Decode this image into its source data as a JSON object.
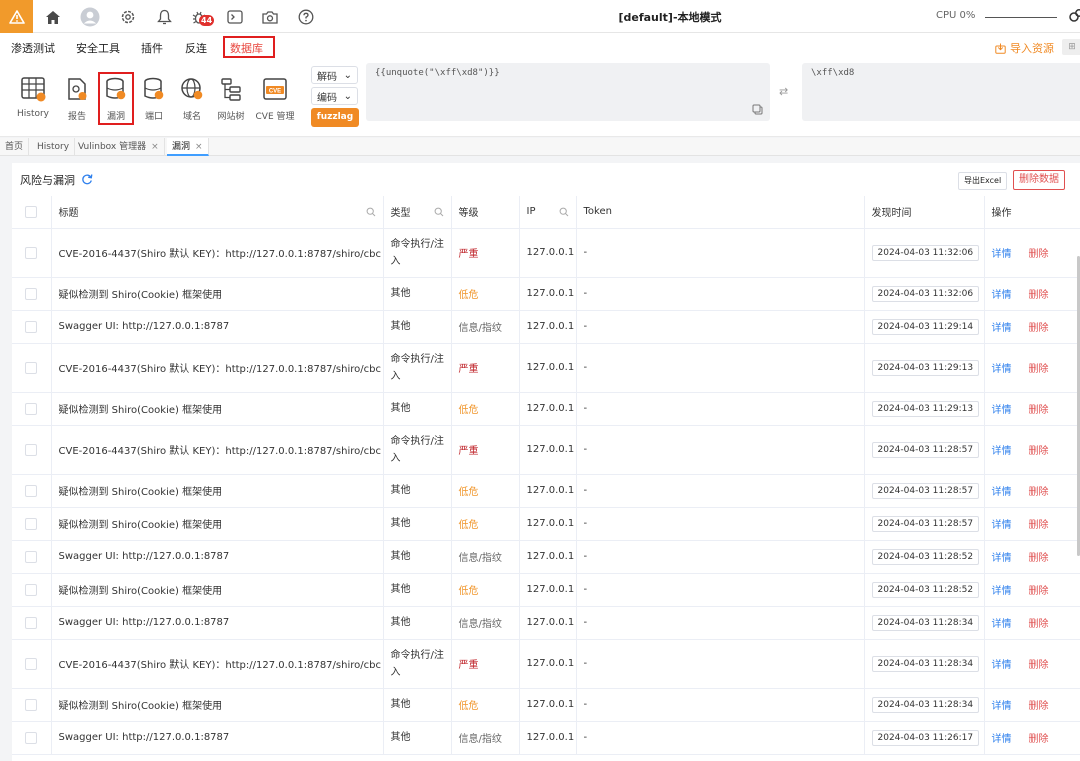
{
  "topbar": {
    "title": "[default]-本地模式",
    "cpu": "CPU 0%",
    "bug_count": "44",
    "icons": [
      "warning-icon",
      "home-icon",
      "user-icon",
      "settings-icon",
      "bell-icon",
      "bug-icon",
      "terminal-icon",
      "camera-icon",
      "help-icon"
    ]
  },
  "menu": {
    "items": [
      "渗透测试",
      "安全工具",
      "插件",
      "反连",
      "数据库"
    ],
    "active_index": 4,
    "import_label": "导入资源"
  },
  "toolbar": {
    "tools": [
      {
        "label": "History",
        "icon": "table-icon"
      },
      {
        "label": "报告",
        "icon": "report-icon"
      },
      {
        "label": "漏洞",
        "icon": "vuln-db-icon"
      },
      {
        "label": "端口",
        "icon": "port-db-icon"
      },
      {
        "label": "域名",
        "icon": "globe-icon"
      },
      {
        "label": "网站树",
        "icon": "tree-icon"
      },
      {
        "label": "CVE 管理",
        "icon": "cve-icon"
      }
    ],
    "decode_label": "解码",
    "encode_label": "编码",
    "fuzz_label": "fuzzlag",
    "input_text": "{{unquote(\"\\xff\\xd8\")}}",
    "output_text": "\\xff\\xd8"
  },
  "tabs": [
    {
      "label": "首页",
      "closable": false
    },
    {
      "label": "History",
      "closable": false
    },
    {
      "label": "Vulinbox 管理器",
      "closable": true
    },
    {
      "label": "漏洞",
      "closable": true,
      "active": true
    }
  ],
  "panel": {
    "title": "风险与漏洞",
    "export_label": "导出Excel",
    "delete_all_label": "删除数据"
  },
  "columns": [
    "标题",
    "类型",
    "等级",
    "IP",
    "Token",
    "发现时间",
    "操作"
  ],
  "actions": {
    "detail": "详情",
    "delete": "删除"
  },
  "rows": [
    {
      "title": "CVE-2016-4437(Shiro 默认 KEY)：http://127.0.0.1:8787/shiro/cbc",
      "type": "命令执行/注入",
      "level": "严重",
      "lv": "crit",
      "ip": "127.0.0.1",
      "token": "-",
      "time": "2024-04-03 11:32:06",
      "tall": true
    },
    {
      "title": "疑似检测到 Shiro(Cookie) 框架使用",
      "type": "其他",
      "level": "低危",
      "lv": "low",
      "ip": "127.0.0.1",
      "token": "-",
      "time": "2024-04-03 11:32:06",
      "tall": false
    },
    {
      "title": "Swagger UI: http://127.0.0.1:8787",
      "type": "其他",
      "level": "信息/指纹",
      "lv": "info",
      "ip": "127.0.0.1",
      "token": "-",
      "time": "2024-04-03 11:29:14",
      "tall": false
    },
    {
      "title": "CVE-2016-4437(Shiro 默认 KEY)：http://127.0.0.1:8787/shiro/cbc",
      "type": "命令执行/注入",
      "level": "严重",
      "lv": "crit",
      "ip": "127.0.0.1",
      "token": "-",
      "time": "2024-04-03 11:29:13",
      "tall": true
    },
    {
      "title": "疑似检测到 Shiro(Cookie) 框架使用",
      "type": "其他",
      "level": "低危",
      "lv": "low",
      "ip": "127.0.0.1",
      "token": "-",
      "time": "2024-04-03 11:29:13",
      "tall": false
    },
    {
      "title": "CVE-2016-4437(Shiro 默认 KEY)：http://127.0.0.1:8787/shiro/cbc",
      "type": "命令执行/注入",
      "level": "严重",
      "lv": "crit",
      "ip": "127.0.0.1",
      "token": "-",
      "time": "2024-04-03 11:28:57",
      "tall": true
    },
    {
      "title": "疑似检测到 Shiro(Cookie) 框架使用",
      "type": "其他",
      "level": "低危",
      "lv": "low",
      "ip": "127.0.0.1",
      "token": "-",
      "time": "2024-04-03 11:28:57",
      "tall": false
    },
    {
      "title": "疑似检测到 Shiro(Cookie) 框架使用",
      "type": "其他",
      "level": "低危",
      "lv": "low",
      "ip": "127.0.0.1",
      "token": "-",
      "time": "2024-04-03 11:28:57",
      "tall": false
    },
    {
      "title": "Swagger UI: http://127.0.0.1:8787",
      "type": "其他",
      "level": "信息/指纹",
      "lv": "info",
      "ip": "127.0.0.1",
      "token": "-",
      "time": "2024-04-03 11:28:52",
      "tall": false
    },
    {
      "title": "疑似检测到 Shiro(Cookie) 框架使用",
      "type": "其他",
      "level": "低危",
      "lv": "low",
      "ip": "127.0.0.1",
      "token": "-",
      "time": "2024-04-03 11:28:52",
      "tall": false
    },
    {
      "title": "Swagger UI: http://127.0.0.1:8787",
      "type": "其他",
      "level": "信息/指纹",
      "lv": "info",
      "ip": "127.0.0.1",
      "token": "-",
      "time": "2024-04-03 11:28:34",
      "tall": false
    },
    {
      "title": "CVE-2016-4437(Shiro 默认 KEY)：http://127.0.0.1:8787/shiro/cbc",
      "type": "命令执行/注入",
      "level": "严重",
      "lv": "crit",
      "ip": "127.0.0.1",
      "token": "-",
      "time": "2024-04-03 11:28:34",
      "tall": true
    },
    {
      "title": "疑似检测到 Shiro(Cookie) 框架使用",
      "type": "其他",
      "level": "低危",
      "lv": "low",
      "ip": "127.0.0.1",
      "token": "-",
      "time": "2024-04-03 11:28:34",
      "tall": false
    },
    {
      "title": "Swagger UI: http://127.0.0.1:8787",
      "type": "其他",
      "level": "信息/指纹",
      "lv": "info",
      "ip": "127.0.0.1",
      "token": "-",
      "time": "2024-04-03 11:26:17",
      "tall": false
    }
  ]
}
